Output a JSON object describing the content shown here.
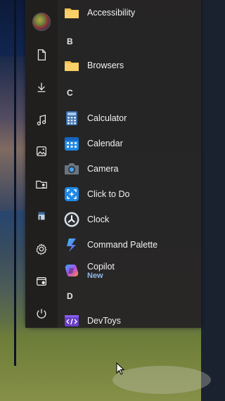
{
  "rail": [
    {
      "name": "user-avatar",
      "icon": "avatar"
    },
    {
      "name": "documents-icon",
      "icon": "document"
    },
    {
      "name": "downloads-icon",
      "icon": "download"
    },
    {
      "name": "music-icon",
      "icon": "music-note"
    },
    {
      "name": "pictures-icon",
      "icon": "picture"
    },
    {
      "name": "user-folder-icon",
      "icon": "folder-person"
    },
    {
      "name": "app-icon",
      "icon": "small-app"
    },
    {
      "name": "settings-icon",
      "icon": "gear"
    },
    {
      "name": "file-explorer-icon",
      "icon": "explorer"
    },
    {
      "name": "power-icon",
      "icon": "power"
    }
  ],
  "apps": {
    "accessibility": "Accessibility",
    "letter_b": "B",
    "browsers": "Browsers",
    "letter_c": "C",
    "calculator": "Calculator",
    "calendar": "Calendar",
    "camera": "Camera",
    "click_to_do": "Click to Do",
    "clock": "Clock",
    "command_palette": "Command Palette",
    "copilot": "Copilot",
    "copilot_badge": "New",
    "letter_d": "D",
    "devtoys": "DevToys"
  },
  "colors": {
    "folder": "#f2c14e",
    "accent_blue": "#3aa0ff",
    "new_badge": "#8fb8e8"
  }
}
